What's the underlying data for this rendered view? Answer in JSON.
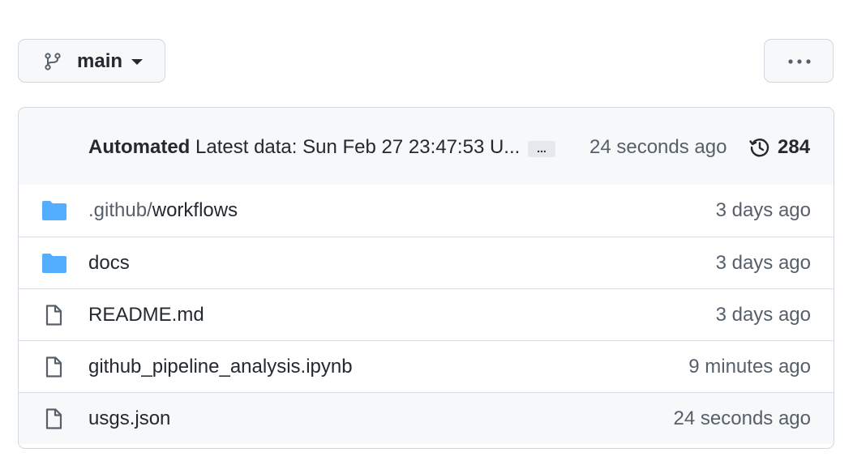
{
  "branch": {
    "label": "main",
    "icon": "git-branch-icon"
  },
  "more_menu": {
    "icon": "kebab-horizontal-icon"
  },
  "commit": {
    "author": "Automated",
    "message": "Latest data: Sun Feb 27 23:47:53 U...",
    "expand_label": "...",
    "time": "24 seconds ago",
    "history_icon": "history-icon",
    "history_count": "284"
  },
  "files": [
    {
      "type": "folder",
      "icon": "folder-icon",
      "name_prefix": ".github/",
      "name": "workflows",
      "time": "3 days ago"
    },
    {
      "type": "folder",
      "icon": "folder-icon",
      "name_prefix": "",
      "name": "docs",
      "time": "3 days ago"
    },
    {
      "type": "file",
      "icon": "file-icon",
      "name_prefix": "",
      "name": "README.md",
      "time": "3 days ago"
    },
    {
      "type": "file",
      "icon": "file-icon",
      "name_prefix": "",
      "name": "github_pipeline_analysis.ipynb",
      "time": "9 minutes ago"
    },
    {
      "type": "file",
      "icon": "file-icon",
      "name_prefix": "",
      "name": "usgs.json",
      "time": "24 seconds ago"
    }
  ],
  "colors": {
    "folder": "#54aeff",
    "muted_text": "#57606a",
    "border": "#d0d7de",
    "header_bg": "#f6f8fa"
  }
}
